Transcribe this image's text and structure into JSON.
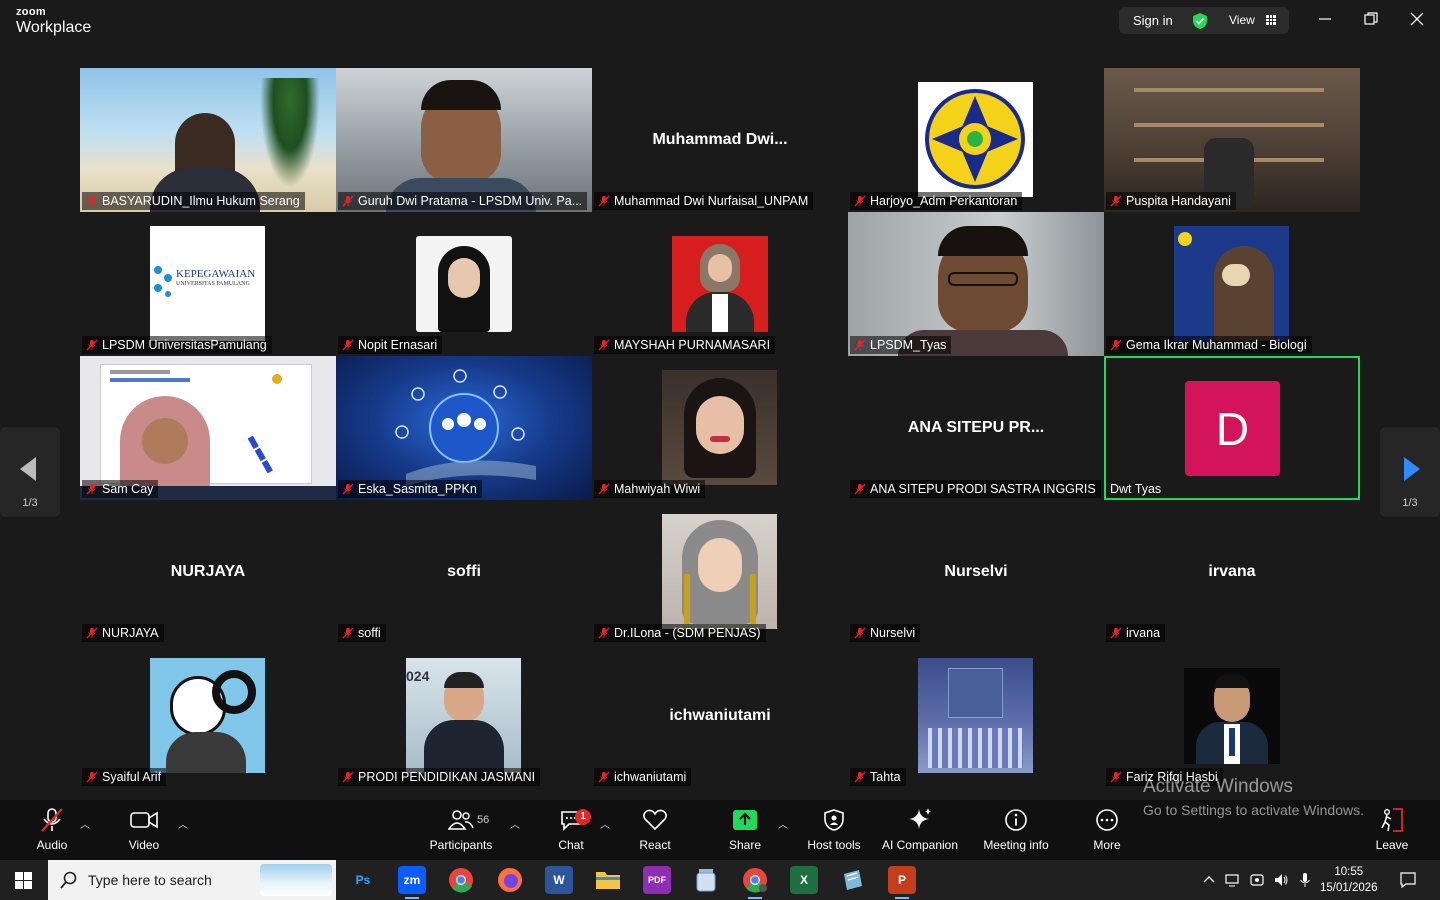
{
  "app": {
    "brand_top": "zoom",
    "brand_bottom": "Workplace"
  },
  "titlebar": {
    "sign_in": "Sign in",
    "view": "View"
  },
  "participants": [
    {
      "name": "BASYARUDIN_Ilmu Hukum Serang",
      "tile": "video",
      "muted": true
    },
    {
      "name": "Guruh Dwi Pratama - LPSDM Univ. Pa...",
      "tile": "video",
      "muted": true
    },
    {
      "name": "Muhammad Dwi Nurfaisal_UNPAM",
      "display": "Muhammad  Dwi...",
      "tile": "name",
      "muted": true
    },
    {
      "name": "Harjoyo_Adm Perkantoran",
      "tile": "avatar",
      "muted": true
    },
    {
      "name": "Puspita Handayani",
      "tile": "video",
      "muted": true
    },
    {
      "name": "LPSDM UniversitasPamulang",
      "tile": "avatar",
      "logo_line1": "KEPEGAWAIAN",
      "logo_line2": "UNIVERSITAS PAMULANG",
      "muted": true
    },
    {
      "name": "Nopit Ernasari",
      "tile": "avatar",
      "muted": true
    },
    {
      "name": "MAYSHAH PURNAMASARI",
      "tile": "avatar",
      "muted": true
    },
    {
      "name": "LPSDM_Tyas",
      "tile": "video",
      "muted": true
    },
    {
      "name": "Gema Ikrar Muhammad - Biologi",
      "tile": "avatar",
      "muted": true
    },
    {
      "name": "Sam Cay",
      "tile": "video",
      "muted": true
    },
    {
      "name": "Eska_Sasmita_PPKn",
      "tile": "video",
      "muted": true
    },
    {
      "name": "Mahwiyah Wiwi",
      "tile": "avatar",
      "muted": true
    },
    {
      "name": "ANA SITEPU PRODI SASTRA INGGRIS",
      "display": "ANA SITEPU PR...",
      "tile": "name",
      "muted": true
    },
    {
      "name": "Dwt Tyas",
      "tile": "letter",
      "letter": "D",
      "muted": false,
      "active_speaker": true
    },
    {
      "name": "NURJAYA",
      "display": "NURJAYA",
      "tile": "name",
      "muted": true
    },
    {
      "name": "soffi",
      "display": "soffi",
      "tile": "name",
      "muted": true
    },
    {
      "name": "Dr.ILona - (SDM PENJAS)",
      "tile": "avatar",
      "muted": true
    },
    {
      "name": "Nurselvi",
      "display": "Nurselvi",
      "tile": "name",
      "muted": true
    },
    {
      "name": "irvana",
      "display": "irvana",
      "tile": "name",
      "muted": true
    },
    {
      "name": "Syaiful Arif",
      "tile": "avatar",
      "muted": true
    },
    {
      "name": "PRODI PENDIDIKAN JASMANI",
      "tile": "avatar",
      "muted": true
    },
    {
      "name": "ichwaniutami",
      "display": "ichwaniutami",
      "tile": "name",
      "muted": true
    },
    {
      "name": "Tahta",
      "tile": "avatar",
      "muted": true
    },
    {
      "name": "Fariz Rifqi Hasbi",
      "tile": "avatar",
      "muted": true
    }
  ],
  "pagination": {
    "left_page": "1/3",
    "right_page": "1/3"
  },
  "toolbar": {
    "audio": "Audio",
    "video": "Video",
    "participants": "Participants",
    "participant_count": "56",
    "chat": "Chat",
    "chat_badge": "1",
    "react": "React",
    "share": "Share",
    "host_tools": "Host tools",
    "ai_companion": "AI Companion",
    "meeting_info": "Meeting info",
    "more": "More",
    "leave": "Leave"
  },
  "watermark": {
    "line1": "Activate Windows",
    "line2": "Go to Settings to activate Windows."
  },
  "taskbar": {
    "search_placeholder": "Type here to search",
    "time": "10:55",
    "date": "15/01/2026",
    "apps": [
      {
        "label": "Ps",
        "color": "#001e36",
        "fg": "#31a8ff"
      },
      {
        "label": "zm",
        "color": "#0b5cff",
        "fg": "#ffffff",
        "active": true
      },
      {
        "label": "",
        "color": "#e8453c"
      },
      {
        "label": "",
        "color": "#ff7139"
      },
      {
        "label": "W",
        "color": "#2b579a",
        "fg": "#ffffff"
      },
      {
        "label": "",
        "color": "#f4c542"
      },
      {
        "label": "PDF",
        "color": "#8e2fb3",
        "fg": "#ffffff"
      },
      {
        "label": "",
        "color": "#6f9fd8"
      },
      {
        "label": "",
        "color": "#4caf50"
      },
      {
        "label": "X",
        "color": "#1d6f42",
        "fg": "#ffffff"
      },
      {
        "label": "",
        "color": "#7fb8d8"
      },
      {
        "label": "P",
        "color": "#c43e1c",
        "fg": "#ffffff"
      }
    ]
  },
  "colors": {
    "active_speaker": "#23d959",
    "muted_icon": "#e02828",
    "letter_avatar": "#d4145a",
    "share_green": "#23d959"
  }
}
